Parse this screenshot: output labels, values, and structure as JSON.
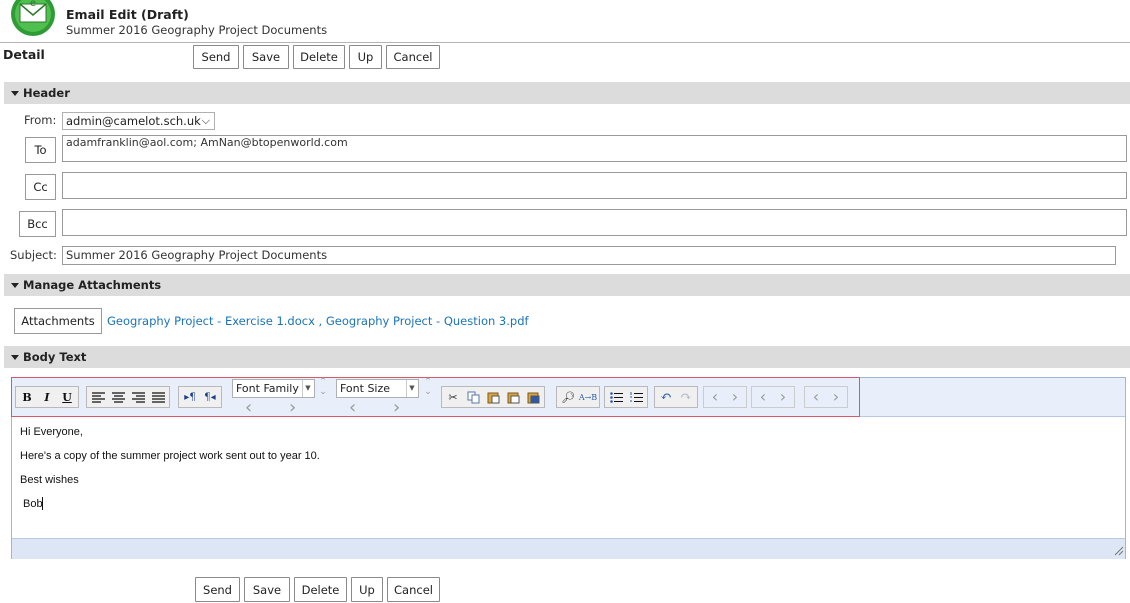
{
  "window": {
    "title": "Email Edit (Draft)",
    "subtitle": "Summer 2016 Geography Project Documents"
  },
  "detail_label": "Detail",
  "toolbar": [
    "Send",
    "Save",
    "Delete",
    "Up",
    "Cancel"
  ],
  "sections": {
    "header": "Header",
    "attachments": "Manage Attachments",
    "body": "Body Text"
  },
  "header": {
    "from_label": "From:",
    "from_value": "admin@camelot.sch.uk",
    "to_button": "To",
    "to_value": "adamfranklin@aol.com; AmNan@btopenworld.com",
    "cc_button": "Cc",
    "cc_value": "",
    "bcc_button": "Bcc",
    "bcc_value": "",
    "subject_label": "Subject:",
    "subject_value": "Summer 2016 Geography Project Documents"
  },
  "attachments": {
    "button": "Attachments",
    "files": [
      "Geography Project - Exercise 1.docx",
      "Geography Project - Question 3.pdf"
    ],
    "separator": " , "
  },
  "editor": {
    "font_family": "Font Family",
    "font_size": "Font Size",
    "lines": [
      "Hi Everyone,",
      "Here's a copy of the summer project work sent out to year 10.",
      "Best wishes",
      "Bob"
    ]
  },
  "footer_toolbar": [
    "Send",
    "Save",
    "Delete",
    "Up",
    "Cancel"
  ]
}
